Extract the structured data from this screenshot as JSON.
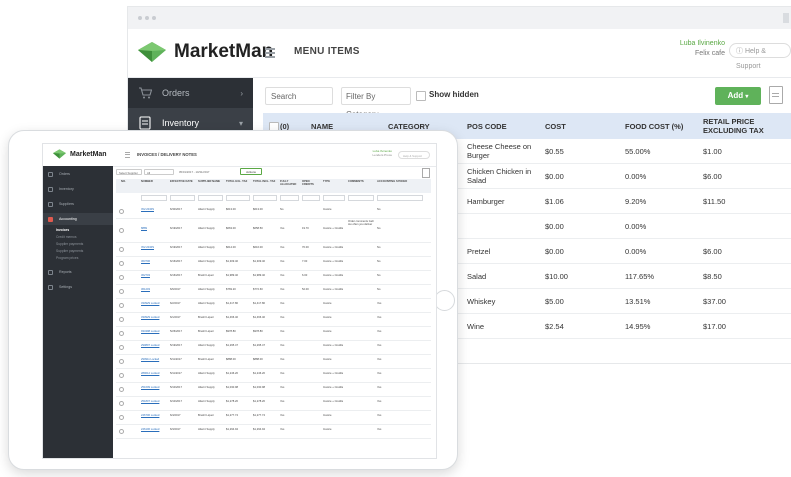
{
  "back_window": {
    "brand": "MarketMan",
    "page_title": "MENU ITEMS",
    "user": {
      "name": "Luba Ilvinenko",
      "company": "Felix cafe"
    },
    "help_label": "Help & Support",
    "sidebar": [
      {
        "label": "Orders",
        "icon": "cart-icon",
        "active": false
      },
      {
        "label": "Inventory",
        "icon": "inventory-icon",
        "active": true
      }
    ],
    "toolbar": {
      "search_placeholder": "Search",
      "filter_label": "Filter By Category",
      "show_hidden_label": "Show hidden",
      "add_label": "Add",
      "add_icon": "plus-icon"
    },
    "table": {
      "select_all_label": "(0)",
      "columns": [
        "NAME",
        "CATEGORY",
        "POS CODE",
        "COST",
        "FOOD COST (%)",
        "RETAIL PRICE EXCLUDING TAX"
      ],
      "rows": [
        {
          "pos_code": "Cheese Cheese on Burger",
          "cost": "$0.55",
          "food_cost": "55.00%",
          "retail": "$1.00"
        },
        {
          "pos_code": "Chicken Chicken in Salad",
          "cost": "$0.00",
          "food_cost": "0.00%",
          "retail": "$6.00"
        },
        {
          "pos_code": "Hamburger",
          "cost": "$1.06",
          "food_cost": "9.20%",
          "retail": "$11.50"
        },
        {
          "pos_code": "",
          "cost": "$0.00",
          "food_cost": "0.00%",
          "retail": ""
        },
        {
          "pos_code": "Pretzel",
          "cost": "$0.00",
          "food_cost": "0.00%",
          "retail": "$6.00"
        },
        {
          "pos_code": "Salad",
          "cost": "$10.00",
          "food_cost": "117.65%",
          "retail": "$8.50"
        },
        {
          "pos_code": "Whiskey",
          "cost": "$5.00",
          "food_cost": "13.51%",
          "retail": "$37.00"
        },
        {
          "pos_code": "Wine",
          "cost": "$2.54",
          "food_cost": "14.95%",
          "retail": "$17.00"
        }
      ]
    }
  },
  "tablet": {
    "brand": "MarketMan",
    "page_title": "INVOICES / DELIVERY NOTES",
    "user": {
      "name": "Luba Ilvinenko",
      "company": "Lenders Proce"
    },
    "help_label": "Help & Support",
    "sidebar": [
      {
        "label": "Orders"
      },
      {
        "label": "Inventory"
      },
      {
        "label": "Suppliers"
      },
      {
        "label": "Accounting",
        "active": true
      },
      {
        "label": "Reports"
      },
      {
        "label": "Settings"
      }
    ],
    "accounting_sub": [
      "Invoices",
      "Credit memos",
      "Supplier payments",
      "Supplier payments",
      "Program prices"
    ],
    "toolbar": {
      "supplier_select": "Select Supplier",
      "all_select": "All",
      "date_range": "05/01/2017 - 10/31/2017",
      "actions_label": "Actions"
    },
    "columns": [
      "NO.",
      "NUMBER",
      "EFFECTIVE DATE",
      "SUPPLIER NAME",
      "TOTAL EXL. TAX",
      "TOTAL INCL. TAX",
      "FULLY ALLOCATED",
      "OPEN CREDITS",
      "TYPE",
      "COMMENTS",
      "ACCOUNTING SYNCED"
    ],
    "rows": [
      {
        "number": "INV-2040S",
        "date": "6/30/2017",
        "supplier": "Alternt Supply",
        "exl": "$613.00",
        "incl": "$613.00",
        "alloc": "No",
        "credits": "",
        "type": "Invoice",
        "comments": "",
        "synced": "No"
      },
      {
        "number": "8889",
        "date": "6/19/2017",
        "supplier": "Alternt Supply",
        "exl": "$663.00",
        "incl": "$658.50",
        "alloc": "Yes",
        "credits": "19.70",
        "type": "Invoice + Credits",
        "comments": "Order comments Gefi too often you deliver",
        "synced": "No"
      },
      {
        "number": "INV-2040S",
        "date": "6/19/2017",
        "supplier": "Alternt Supply",
        "exl": "$614.00",
        "incl": "$616.00",
        "alloc": "Yes",
        "credits": "70.00",
        "type": "Invoice + Credits",
        "comments": "",
        "synced": "No"
      },
      {
        "number": "363706",
        "date": "6/16/2017",
        "supplier": "Alternt Supply",
        "exl": "$1,309.40",
        "incl": "$1,309.40",
        "alloc": "Yes",
        "credits": "7.00",
        "type": "Invoice + Credits",
        "comments": "",
        "synced": "No"
      },
      {
        "number": "362703",
        "date": "6/16/2017",
        "supplier": "Brushl Liquor",
        "exl": "$1,989.40",
        "incl": "$1,989.40",
        "alloc": "Yes",
        "credits": "6.00",
        "type": "Invoice + Credits",
        "comments": "",
        "synced": "No"
      },
      {
        "number": "361203",
        "date": "6/6/2017",
        "supplier": "Alternt Supply",
        "exl": "$769.20",
        "incl": "$772.60",
        "alloc": "Yes",
        "credits": "52.00",
        "type": "Invoice + Credits",
        "comments": "",
        "synced": "No"
      },
      {
        "number": "333929 Locked",
        "date": "6/2/2017",
        "supplier": "Alternt Supply",
        "exl": "$1,417.80",
        "incl": "$1,417.80",
        "alloc": "Yes",
        "credits": "",
        "type": "Invoice",
        "comments": "",
        "synced": "Yes"
      },
      {
        "number": "333929 Locked",
        "date": "6/1/2017",
        "supplier": "Brushl Liquor",
        "exl": "$1,466.40",
        "incl": "$1,466.40",
        "alloc": "Yes",
        "credits": "",
        "type": "Invoice",
        "comments": "",
        "synced": "Yes"
      },
      {
        "number": "934398 Locked",
        "date": "5/26/2017",
        "supplier": "Brushl Liquor",
        "exl": "$978.80",
        "incl": "$978.80",
        "alloc": "Yes",
        "credits": "",
        "type": "Invoice",
        "comments": "",
        "synced": "Yes"
      },
      {
        "number": "290897 Locked",
        "date": "5/19/2017",
        "supplier": "Alternt Supply",
        "exl": "$1,295.47",
        "incl": "$1,295.47",
        "alloc": "Yes",
        "credits": "",
        "type": "Invoice + Credits",
        "comments": "",
        "synced": "Yes"
      },
      {
        "number": "290911 Locked",
        "date": "5/11/2017",
        "supplier": "Brushl Liquor",
        "exl": "$888.00",
        "incl": "$888.00",
        "alloc": "Yes",
        "credits": "",
        "type": "Invoice",
        "comments": "",
        "synced": "Yes"
      },
      {
        "number": "289612 Locked",
        "date": "5/11/2017",
        "supplier": "Alternt Supply",
        "exl": "$1,246.20",
        "incl": "$1,246.20",
        "alloc": "Yes",
        "credits": "",
        "type": "Invoice + Credits",
        "comments": "",
        "synced": "Yes"
      },
      {
        "number": "251609 Locked",
        "date": "5/10/2017",
        "supplier": "Alternt Supply",
        "exl": "$1,030.98",
        "incl": "$1,030.98",
        "alloc": "Yes",
        "credits": "",
        "type": "Invoice + Credits",
        "comments": "",
        "synced": "Yes"
      },
      {
        "number": "251807 Locked",
        "date": "6/10/2017",
        "supplier": "Alternt Supply",
        "exl": "$1,278.20",
        "incl": "$1,278.20",
        "alloc": "Yes",
        "credits": "",
        "type": "Invoice + Credits",
        "comments": "",
        "synced": "Yes"
      },
      {
        "number": "246706 Locked",
        "date": "6/4/2017",
        "supplier": "Brushl Liquor",
        "exl": "$1,277.74",
        "incl": "$1,277.74",
        "alloc": "Yes",
        "credits": "",
        "type": "Invoice",
        "comments": "",
        "synced": "Yes"
      },
      {
        "number": "246106 Locked",
        "date": "6/3/2017",
        "supplier": "Alternt Supply",
        "exl": "$1,294.94",
        "incl": "$1,294.94",
        "alloc": "Yes",
        "credits": "",
        "type": "Invoice",
        "comments": "",
        "synced": "Yes"
      }
    ]
  },
  "colors": {
    "brand_green": "#5fb25a",
    "sidebar_dark": "#2c3036",
    "header_blue": "#dde7f5",
    "accent_red": "#e05a4f",
    "link_blue": "#2a6ebb"
  }
}
